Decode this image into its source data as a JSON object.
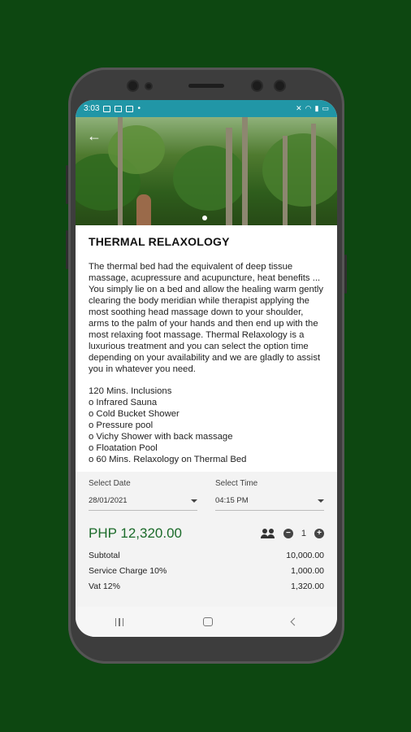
{
  "status_bar": {
    "time": "3:03"
  },
  "hero": {
    "back_icon": "back-arrow-icon"
  },
  "product": {
    "title": "THERMAL RELAXOLOGY",
    "description": "The thermal bed had the equivalent of deep tissue massage, acupressure and acupuncture, heat benefits ... You simply lie on a bed and allow the healing warm gently clearing the body meridian while therapist applying the most soothing head massage down to your shoulder, arms to the palm of your hands and then end up with the most relaxing foot massage. Thermal Relaxology is a luxurious treatment and you can select the option time depending on your availability and we are gladly to assist you in whatever you need.",
    "inclusions_heading": "120 Mins. Inclusions",
    "inclusions": [
      "o Infrared Sauna",
      "o Cold Bucket Shower",
      "o Pressure pool",
      "o Vichy Shower with back massage",
      "o Floatation Pool",
      "o 60 Mins. Relaxology on Thermal Bed"
    ]
  },
  "booking": {
    "date_label": "Select Date",
    "date_value": "28/01/2021",
    "time_label": "Select Time",
    "time_value": "04:15 PM",
    "price": "PHP 12,320.00",
    "quantity": "1",
    "minus": "−",
    "plus": "+",
    "subtotal_label": "Subtotal",
    "subtotal_value": "10,000.00",
    "service_label": "Service Charge 10%",
    "service_value": "1,000.00",
    "vat_label": "Vat 12%",
    "vat_value": "1,320.00"
  },
  "colors": {
    "background": "#0d4711",
    "status_bar": "#2196a6",
    "price": "#1b6b2a"
  }
}
